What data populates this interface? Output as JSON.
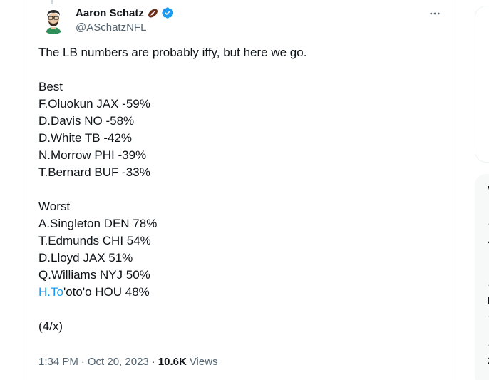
{
  "author": {
    "display_name": "Aaron Schatz",
    "handle": "@ASchatzNFL",
    "badge_emoji": "football-icon",
    "verified": true
  },
  "tweet": {
    "intro": "The LB numbers are probably iffy, but here we go.",
    "best_heading": "Best",
    "best": [
      "F.Oluokun JAX -59%",
      "D.Davis NO -58%",
      "D.White TB -42%",
      "N.Morrow PHI -39%",
      "T.Bernard BUF -33%"
    ],
    "worst_heading": "Worst",
    "worst": [
      "A.Singleton DEN 78%",
      "T.Edmunds CHI 54%",
      "D.Lloyd JAX 51%",
      "Q.Williams NYJ 50%"
    ],
    "last_worst": {
      "mention": "H.To",
      "rest": "'oto'o HOU 48%"
    },
    "footer": "(4/x)"
  },
  "meta": {
    "time": "1:34 PM",
    "separator": "·",
    "date": "Oct 20, 2023",
    "views_count": "10.6K",
    "views_label": "Views"
  },
  "colors": {
    "accent": "#1d9bf0",
    "secondary_text": "#536471",
    "primary_text": "#0f1419",
    "football": "#5b2a1a"
  }
}
